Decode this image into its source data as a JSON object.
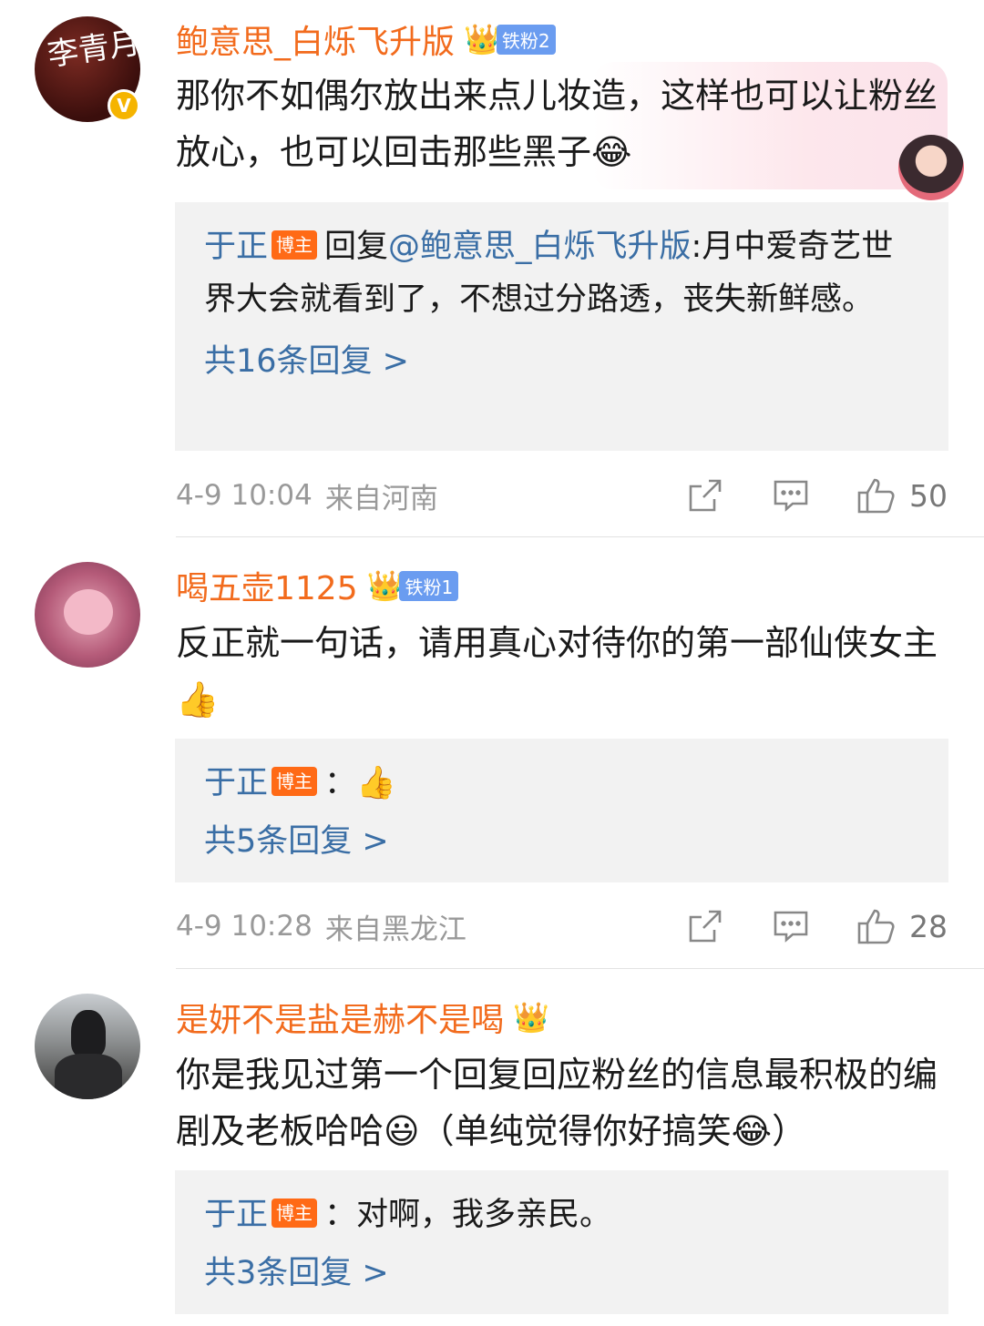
{
  "comments": [
    {
      "avatar_text": "李青月",
      "username": "鲍意思_白烁飞升版",
      "fan_level": "铁粉2",
      "text": "那你不如偶尔放出来点儿妆造，这样也可以让粉丝放心，也可以回击那些黑子",
      "emoji": "😂",
      "reply": {
        "author": "于正",
        "host_badge": "博主",
        "prefix": "回复",
        "mention": "@鲍意思_白烁飞升版",
        "text": ":月中爱奇艺世界大会就看到了，不想过分路透，丧失新鲜感。"
      },
      "more_replies": "共16条回复 >",
      "time": "4-9 10:04",
      "location": "来自河南",
      "likes": "50"
    },
    {
      "username": "喝五壶1125",
      "fan_level": "铁粉1",
      "text": "反正就一句话，请用真心对待你的第一部仙侠女主",
      "emoji": "👍",
      "reply": {
        "author": "于正",
        "host_badge": "博主",
        "text": "：👍"
      },
      "more_replies": "共5条回复 >",
      "time": "4-9 10:28",
      "location": "来自黑龙江",
      "likes": "28"
    },
    {
      "username": "是妍不是盐是赫不是喝",
      "text_part1": "你是我见过第一个回复回应粉丝的信息最积极的编剧及老板哈哈",
      "emoji1": "😃",
      "text_part2": "（单纯觉得你好搞笑",
      "emoji2": "😂",
      "text_part3": "）",
      "reply": {
        "author": "于正",
        "host_badge": "博主",
        "text": "：对啊，我多亲民。"
      },
      "more_replies": "共3条回复 >"
    }
  ],
  "icons": {
    "share": "share-icon",
    "comment": "comment-icon",
    "like": "thumbs-up-icon",
    "verified": "verified-v-icon",
    "crown": "crown-icon"
  },
  "colors": {
    "username": "#f26b1d",
    "link": "#3a6ea5",
    "host_badge": "#ff6a16",
    "fan_badge": "#6a9cf0",
    "meta": "#999999",
    "reply_bg": "#f2f2f2"
  }
}
